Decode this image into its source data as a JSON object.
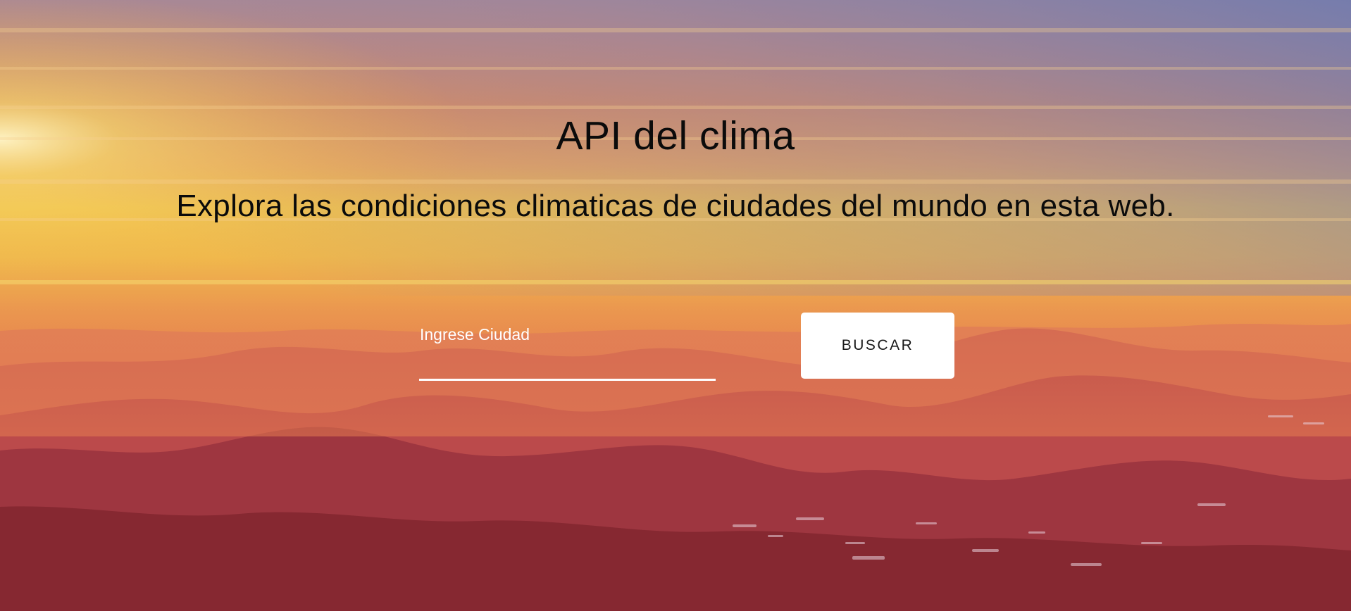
{
  "page": {
    "title": "API del clima",
    "subtitle": "Explora las condiciones climaticas de ciudades del mundo en esta web."
  },
  "search": {
    "label": "Ingrese Ciudad",
    "value": "",
    "button_label": "BUSCAR"
  },
  "colors": {
    "sky_top": "#8a84a6",
    "sky_glow": "#f2c845",
    "horizon": "#e8864a",
    "mountains_far": "#c8584a",
    "mountains_near": "#8c2a2a",
    "text": "#0b0b0b",
    "button_bg": "#ffffff"
  }
}
